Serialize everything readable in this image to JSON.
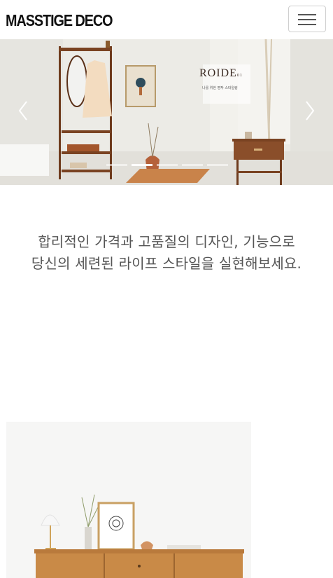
{
  "header": {
    "logo": "MASSTIGE DECO",
    "menu_icon": "hamburger-menu-icon"
  },
  "hero": {
    "brand": "ROIDE",
    "brand_suffix": "01",
    "subtitle": "나를 위한 명작 스타일링",
    "prev_icon": "chevron-left-icon",
    "next_icon": "chevron-right-icon",
    "slide_count": 5,
    "active_slide": 2
  },
  "intro": {
    "line1": "합리적인 가격과 고품질의 디자인, 기능으로",
    "line2": "당신의 세련된 라이프 스타일을 실현해보세요."
  },
  "colors": {
    "wood": "#8a4e2a",
    "wall": "#ecebe6",
    "text": "#555555"
  }
}
